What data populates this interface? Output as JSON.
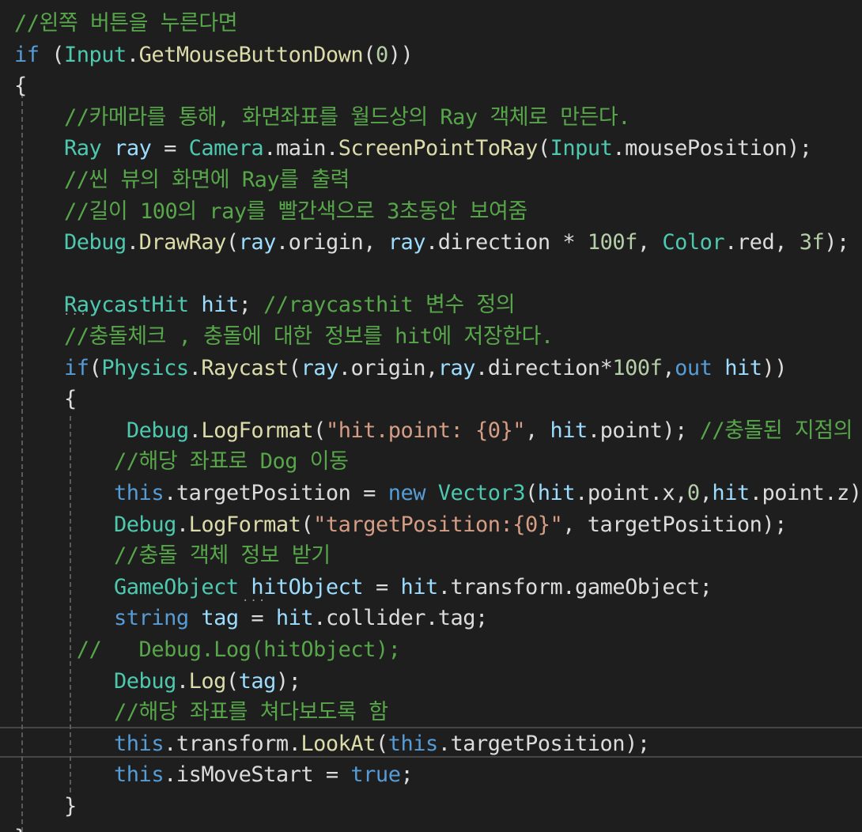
{
  "editor": {
    "language": "C#",
    "theme_colors": {
      "background": "#1e1e1e",
      "comment": "#57a64a",
      "keyword": "#569cd6",
      "type": "#4ec9b0",
      "method": "#dcdcaa",
      "variable": "#9cdcfe",
      "string": "#d69d85",
      "number": "#b5cea8",
      "plain": "#dcdcdc"
    },
    "lines": [
      [
        {
          "t": "//왼쪽 버튼을 누른다면",
          "c": "cmt"
        }
      ],
      [
        {
          "t": "if",
          "c": "kw"
        },
        {
          "t": " (",
          "c": "pl"
        },
        {
          "t": "Input",
          "c": "cls"
        },
        {
          "t": ".",
          "c": "pl"
        },
        {
          "t": "GetMouseButtonDown",
          "c": "mth"
        },
        {
          "t": "(",
          "c": "pl"
        },
        {
          "t": "0",
          "c": "num"
        },
        {
          "t": "))",
          "c": "pl"
        }
      ],
      [
        {
          "t": "{",
          "c": "pl"
        }
      ],
      [
        {
          "t": "    ",
          "c": "pl"
        },
        {
          "t": "//카메라를 통해, 화면좌표를 월드상의 Ray 객체로 만든다.",
          "c": "cmt"
        }
      ],
      [
        {
          "t": "    ",
          "c": "pl"
        },
        {
          "t": "Ray",
          "c": "cls"
        },
        {
          "t": " ",
          "c": "pl"
        },
        {
          "t": "ray",
          "c": "var"
        },
        {
          "t": " = ",
          "c": "pl"
        },
        {
          "t": "Camera",
          "c": "cls"
        },
        {
          "t": ".main.",
          "c": "pl"
        },
        {
          "t": "ScreenPointToRay",
          "c": "mth"
        },
        {
          "t": "(",
          "c": "pl"
        },
        {
          "t": "Input",
          "c": "cls"
        },
        {
          "t": ".mousePosition);",
          "c": "pl"
        }
      ],
      [
        {
          "t": "    ",
          "c": "pl"
        },
        {
          "t": "//씬 뷰의 화면에 Ray를 출력",
          "c": "cmt"
        }
      ],
      [
        {
          "t": "    ",
          "c": "pl"
        },
        {
          "t": "//길이 100의 ray를 빨간색으로 3초동안 보여줌",
          "c": "cmt"
        }
      ],
      [
        {
          "t": "    ",
          "c": "pl"
        },
        {
          "t": "Debug",
          "c": "cls"
        },
        {
          "t": ".",
          "c": "pl"
        },
        {
          "t": "DrawRay",
          "c": "mth"
        },
        {
          "t": "(",
          "c": "pl"
        },
        {
          "t": "ray",
          "c": "var"
        },
        {
          "t": ".origin, ",
          "c": "pl"
        },
        {
          "t": "ray",
          "c": "var"
        },
        {
          "t": ".direction * ",
          "c": "pl"
        },
        {
          "t": "100f",
          "c": "num"
        },
        {
          "t": ", ",
          "c": "pl"
        },
        {
          "t": "Color",
          "c": "cls"
        },
        {
          "t": ".red, ",
          "c": "pl"
        },
        {
          "t": "3f",
          "c": "num"
        },
        {
          "t": ");",
          "c": "pl"
        }
      ],
      [],
      [
        {
          "t": "    ",
          "c": "pl"
        },
        {
          "t": "RaycastHit",
          "c": "cls"
        },
        {
          "t": " ",
          "c": "pl"
        },
        {
          "t": "hit",
          "c": "var"
        },
        {
          "t": "; ",
          "c": "pl"
        },
        {
          "t": "//raycasthit 변수 정의",
          "c": "cmt"
        }
      ],
      [
        {
          "t": "    ",
          "c": "pl"
        },
        {
          "t": "//충돌체크 , 충돌에 대한 정보를 hit에 저장한다.",
          "c": "cmt"
        }
      ],
      [
        {
          "t": "    ",
          "c": "pl"
        },
        {
          "t": "if",
          "c": "kw"
        },
        {
          "t": "(",
          "c": "pl"
        },
        {
          "t": "Physics",
          "c": "cls"
        },
        {
          "t": ".",
          "c": "pl"
        },
        {
          "t": "Raycast",
          "c": "mth"
        },
        {
          "t": "(",
          "c": "pl"
        },
        {
          "t": "ray",
          "c": "var"
        },
        {
          "t": ".origin,",
          "c": "pl"
        },
        {
          "t": "ray",
          "c": "var"
        },
        {
          "t": ".direction*",
          "c": "pl"
        },
        {
          "t": "100f",
          "c": "num"
        },
        {
          "t": ",",
          "c": "pl"
        },
        {
          "t": "out",
          "c": "kw"
        },
        {
          "t": " ",
          "c": "pl"
        },
        {
          "t": "hit",
          "c": "var"
        },
        {
          "t": "))",
          "c": "pl"
        }
      ],
      [
        {
          "t": "    {",
          "c": "pl"
        }
      ],
      [
        {
          "t": "         ",
          "c": "pl"
        },
        {
          "t": "Debug",
          "c": "cls"
        },
        {
          "t": ".",
          "c": "pl"
        },
        {
          "t": "LogFormat",
          "c": "mth"
        },
        {
          "t": "(",
          "c": "pl"
        },
        {
          "t": "\"hit.point: {0}\"",
          "c": "str"
        },
        {
          "t": ", ",
          "c": "pl"
        },
        {
          "t": "hit",
          "c": "var"
        },
        {
          "t": ".point); ",
          "c": "pl"
        },
        {
          "t": "//충돌된 지점의",
          "c": "cmt"
        }
      ],
      [
        {
          "t": "        ",
          "c": "pl"
        },
        {
          "t": "//해당 좌표로 Dog 이동",
          "c": "cmt"
        }
      ],
      [
        {
          "t": "        ",
          "c": "pl"
        },
        {
          "t": "this",
          "c": "kw"
        },
        {
          "t": ".targetPosition = ",
          "c": "pl"
        },
        {
          "t": "new",
          "c": "kw"
        },
        {
          "t": " ",
          "c": "pl"
        },
        {
          "t": "Vector3",
          "c": "cls"
        },
        {
          "t": "(",
          "c": "pl"
        },
        {
          "t": "hit",
          "c": "var"
        },
        {
          "t": ".point.x,",
          "c": "pl"
        },
        {
          "t": "0",
          "c": "num"
        },
        {
          "t": ",",
          "c": "pl"
        },
        {
          "t": "hit",
          "c": "var"
        },
        {
          "t": ".point.z);",
          "c": "pl"
        }
      ],
      [
        {
          "t": "        ",
          "c": "pl"
        },
        {
          "t": "Debug",
          "c": "cls"
        },
        {
          "t": ".",
          "c": "pl"
        },
        {
          "t": "LogFormat",
          "c": "mth"
        },
        {
          "t": "(",
          "c": "pl"
        },
        {
          "t": "\"targetPosition:{0}\"",
          "c": "str"
        },
        {
          "t": ", targetPosition);",
          "c": "pl"
        }
      ],
      [
        {
          "t": "        ",
          "c": "pl"
        },
        {
          "t": "//충돌 객체 정보 받기",
          "c": "cmt"
        }
      ],
      [
        {
          "t": "        ",
          "c": "pl"
        },
        {
          "t": "GameObject",
          "c": "cls"
        },
        {
          "t": " ",
          "c": "pl"
        },
        {
          "t": "hitObject",
          "c": "var"
        },
        {
          "t": " = ",
          "c": "pl"
        },
        {
          "t": "hit",
          "c": "var"
        },
        {
          "t": ".transform.gameObject;",
          "c": "pl"
        }
      ],
      [
        {
          "t": "        ",
          "c": "pl"
        },
        {
          "t": "string",
          "c": "kw"
        },
        {
          "t": " ",
          "c": "pl"
        },
        {
          "t": "tag",
          "c": "var"
        },
        {
          "t": " = ",
          "c": "pl"
        },
        {
          "t": "hit",
          "c": "var"
        },
        {
          "t": ".collider.tag;",
          "c": "pl"
        }
      ],
      [
        {
          "t": "     ",
          "c": "pl"
        },
        {
          "t": "//   Debug.Log(hitObject);",
          "c": "cmt"
        }
      ],
      [
        {
          "t": "        ",
          "c": "pl"
        },
        {
          "t": "Debug",
          "c": "cls"
        },
        {
          "t": ".",
          "c": "pl"
        },
        {
          "t": "Log",
          "c": "mth"
        },
        {
          "t": "(",
          "c": "pl"
        },
        {
          "t": "tag",
          "c": "var"
        },
        {
          "t": ");",
          "c": "pl"
        }
      ],
      [
        {
          "t": "        ",
          "c": "pl"
        },
        {
          "t": "//해당 좌표를 쳐다보도록 함",
          "c": "cmt"
        }
      ],
      [
        {
          "t": "        ",
          "c": "pl"
        },
        {
          "t": "this",
          "c": "kw"
        },
        {
          "t": ".transform.",
          "c": "pl"
        },
        {
          "t": "LookAt",
          "c": "mth"
        },
        {
          "t": "(",
          "c": "pl"
        },
        {
          "t": "this",
          "c": "kw"
        },
        {
          "t": ".targetPosition);",
          "c": "pl"
        }
      ],
      [
        {
          "t": "        ",
          "c": "pl"
        },
        {
          "t": "this",
          "c": "kw"
        },
        {
          "t": ".isMoveStart = ",
          "c": "pl"
        },
        {
          "t": "true",
          "c": "kw"
        },
        {
          "t": ";",
          "c": "pl"
        }
      ],
      [
        {
          "t": "    }",
          "c": "pl"
        }
      ],
      [
        {
          "t": "}",
          "c": "pl"
        }
      ]
    ]
  }
}
